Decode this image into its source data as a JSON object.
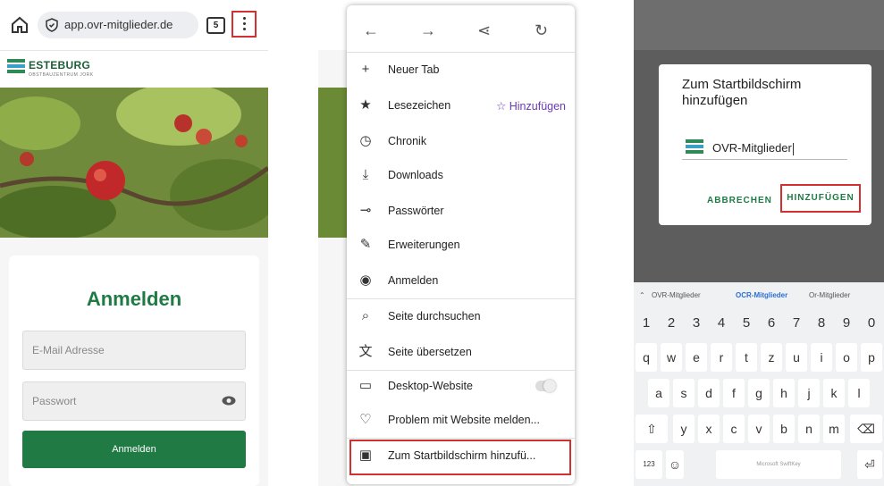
{
  "panel1": {
    "url": "app.ovr-mitglieder.de",
    "tab_count": "5",
    "logo_text": "ESTEBURG",
    "logo_sub": "OBSTBAUZENTRUM JORK",
    "heading": "Anmelden",
    "email_placeholder": "E-Mail Adresse",
    "password_placeholder": "Passwort",
    "login_button": "Anmelden"
  },
  "panel2": {
    "menu_items": [
      {
        "icon": "plus-icon",
        "glyph": "+",
        "label": "Neuer Tab"
      },
      {
        "icon": "star-icon",
        "glyph": "★",
        "label": "Lesezeichen"
      },
      {
        "icon": "history-icon",
        "glyph": "◷",
        "label": "Chronik"
      },
      {
        "icon": "download-icon",
        "glyph": "⤓",
        "label": "Downloads"
      },
      {
        "icon": "key-icon",
        "glyph": "⊸",
        "label": "Passwörter"
      },
      {
        "icon": "puzzle-icon",
        "glyph": "✎",
        "label": "Erweiterungen"
      },
      {
        "icon": "account-icon",
        "glyph": "◉",
        "label": "Anmelden"
      },
      {
        "icon": "search-icon",
        "glyph": "⌕",
        "label": "Seite durchsuchen"
      },
      {
        "icon": "translate-icon",
        "glyph": "文",
        "label": "Seite übersetzen"
      },
      {
        "icon": "desktop-icon",
        "glyph": "▭",
        "label": "Desktop-Website"
      },
      {
        "icon": "bulb-icon",
        "glyph": "♡",
        "label": "Problem mit Website melden..."
      },
      {
        "icon": "home-screen-icon",
        "glyph": "▣",
        "label": "Zum Startbildschirm hinzufü..."
      }
    ],
    "bookmark_add": "☆ Hinzufügen"
  },
  "panel3": {
    "dialog_title": "Zum Startbildschirm hinzufügen",
    "input_value": "OVR-Mitglieder",
    "cancel_button": "ABBRECHEN",
    "add_button": "HINZUFÜGEN",
    "suggestions": [
      "OVR-Mitglieder",
      "OCR-Mitglieder",
      "Or-Mitglieder"
    ],
    "keyboard_brand": "Microsoft SwiftKey",
    "key_numbers": [
      "1",
      "2",
      "3",
      "4",
      "5",
      "6",
      "7",
      "8",
      "9",
      "0"
    ],
    "key_row1": [
      "q",
      "w",
      "e",
      "r",
      "t",
      "z",
      "u",
      "i",
      "o",
      "p"
    ],
    "key_row2": [
      "a",
      "s",
      "d",
      "f",
      "g",
      "h",
      "j",
      "k",
      "l"
    ],
    "key_row3": [
      "y",
      "x",
      "c",
      "v",
      "b",
      "n",
      "m"
    ],
    "key_123": "123"
  },
  "colors": {
    "accent_green": "#1f7a44",
    "highlight_red": "#d32f2f",
    "purple": "#6a3ab2"
  }
}
